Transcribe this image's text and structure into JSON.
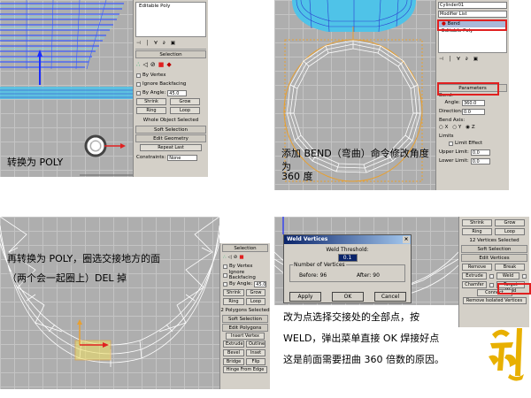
{
  "panel1": {
    "caption": "转换为 POLY",
    "stack_item": "Editable Poly",
    "selection_rollout": "Selection",
    "by_vertex": "By Vertex",
    "ignore_backfacing": "Ignore Backfacing",
    "by_angle": "By Angle:",
    "by_angle_value": "45.0",
    "shrink": "Shrink",
    "grow": "Grow",
    "ring": "Ring",
    "loop": "Loop",
    "status": "Whole Object Selected",
    "soft_selection": "Soft Selection",
    "edit_geometry": "Edit Geometry",
    "repeat_last": "Repeat Last",
    "constraints": "Constraints:",
    "constraints_value": "None"
  },
  "panel2": {
    "caption_line1": "添加 BEND（弯曲）命令修改角度为",
    "caption_line2": "360 度",
    "object_name": "Cylinder01",
    "modifier_list": "Modifier List",
    "stack_bend": "Bend",
    "stack_poly": "Editable Poly",
    "parameters": "Parameters",
    "bend_label": "Bend:",
    "angle_label": "Angle:",
    "angle_value": "360.0",
    "direction_label": "Direction:",
    "direction_value": "0.0",
    "bend_axis": "Bend Axis:",
    "axis_x": "X",
    "axis_y": "Y",
    "axis_z": "Z",
    "limits": "Limits",
    "limit_effect": "Limit Effect",
    "upper_limit": "Upper Limit:",
    "upper_value": "0.0",
    "lower_limit": "Lower Limit:",
    "lower_value": "0.0"
  },
  "panel3": {
    "caption_line1": "再转换为 POLY，圈选交接地方的面",
    "caption_line2": "（两个会一起圈上）DEL 掉",
    "selection_rollout": "Selection",
    "by_vertex": "By Vertex",
    "ignore_backfacing": "Ignore Backfacing",
    "by_angle": "By Angle:",
    "by_angle_value": "45.0",
    "shrink": "Shrink",
    "grow": "Grow",
    "ring": "Ring",
    "loop": "Loop",
    "status": "2 Polygons Selected",
    "soft_selection": "Soft Selection",
    "edit_polygons": "Edit Polygons",
    "insert_vertex": "Insert Vertex",
    "extrude": "Extrude",
    "outline": "Outline",
    "bevel": "Bevel",
    "inset": "Inset",
    "bridge": "Bridge",
    "flip": "Flip",
    "hinge": "Hinge From Edge"
  },
  "panel4": {
    "caption_line1": "改为点选择交接处的全部点，按",
    "caption_line2": "WELD，弹出菜单直接 OK 焊接好点",
    "caption_line3": "这是前面需要扭曲 360 倍数的原因。",
    "dialog_title": "Weld Vertices",
    "weld_threshold": "Weld Threshold:",
    "weld_value": "0.1",
    "number_of_vertices": "Number of Vertices",
    "before_label": "Before:",
    "before_value": "96",
    "after_label": "After:",
    "after_value": "90",
    "apply": "Apply",
    "ok": "OK",
    "cancel": "Cancel",
    "shrink": "Shrink",
    "grow": "Grow",
    "ring": "Ring",
    "loop": "Loop",
    "status": "12 Vertices Selected",
    "soft_selection": "Soft Selection",
    "edit_vertices": "Edit Vertices",
    "remove": "Remove",
    "break": "Break",
    "extrude": "Extrude",
    "weld": "Weld",
    "chamfer": "Chamfer",
    "target_weld": "Target Weld",
    "connect": "Connect",
    "remove_isolated": "Remove Isolated Vertices"
  },
  "colors": {
    "viewport_bg": "#aeaeae",
    "panel_bg": "#d4d0c8",
    "highlight": "#e02020",
    "accent_cyan": "#4fc3e8",
    "wire_white": "#ffffff",
    "gizmo_orange": "#e8a030"
  }
}
